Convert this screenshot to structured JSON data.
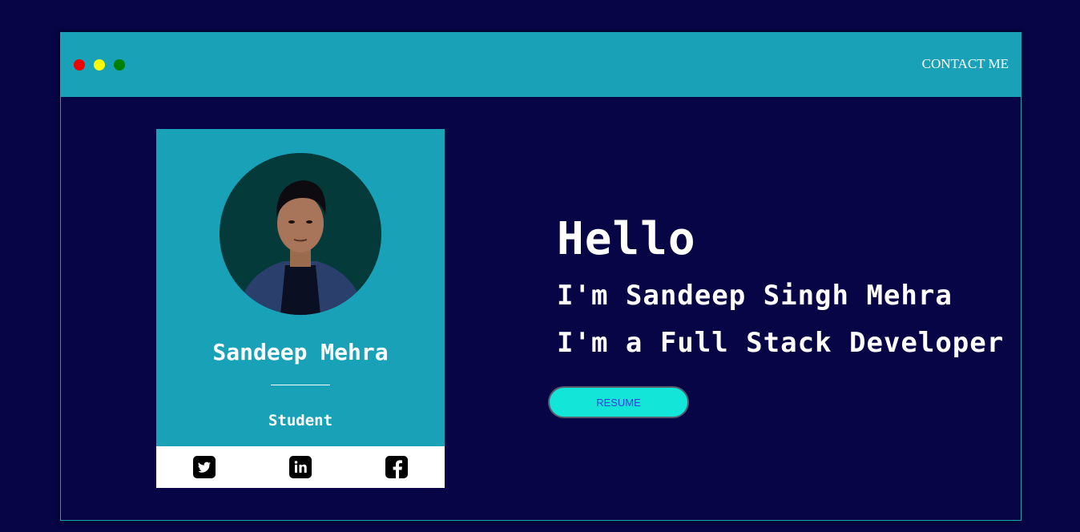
{
  "header": {
    "window_controls": [
      "red",
      "yellow",
      "green"
    ],
    "contact_label": "CONTACT ME"
  },
  "profile_card": {
    "name": "Sandeep Mehra",
    "role": "Student",
    "social_icons": [
      "twitter-icon",
      "linkedin-icon",
      "facebook-icon"
    ]
  },
  "intro": {
    "greeting": "Hello",
    "line1": "I'm Sandeep Singh Mehra",
    "line2": "I'm a Full Stack Developer",
    "resume_label": "RESUME"
  },
  "colors": {
    "page_bg": "#070545",
    "accent": "#19a1b8",
    "button": "#13e6d8",
    "button_text": "#3a3ae0"
  }
}
